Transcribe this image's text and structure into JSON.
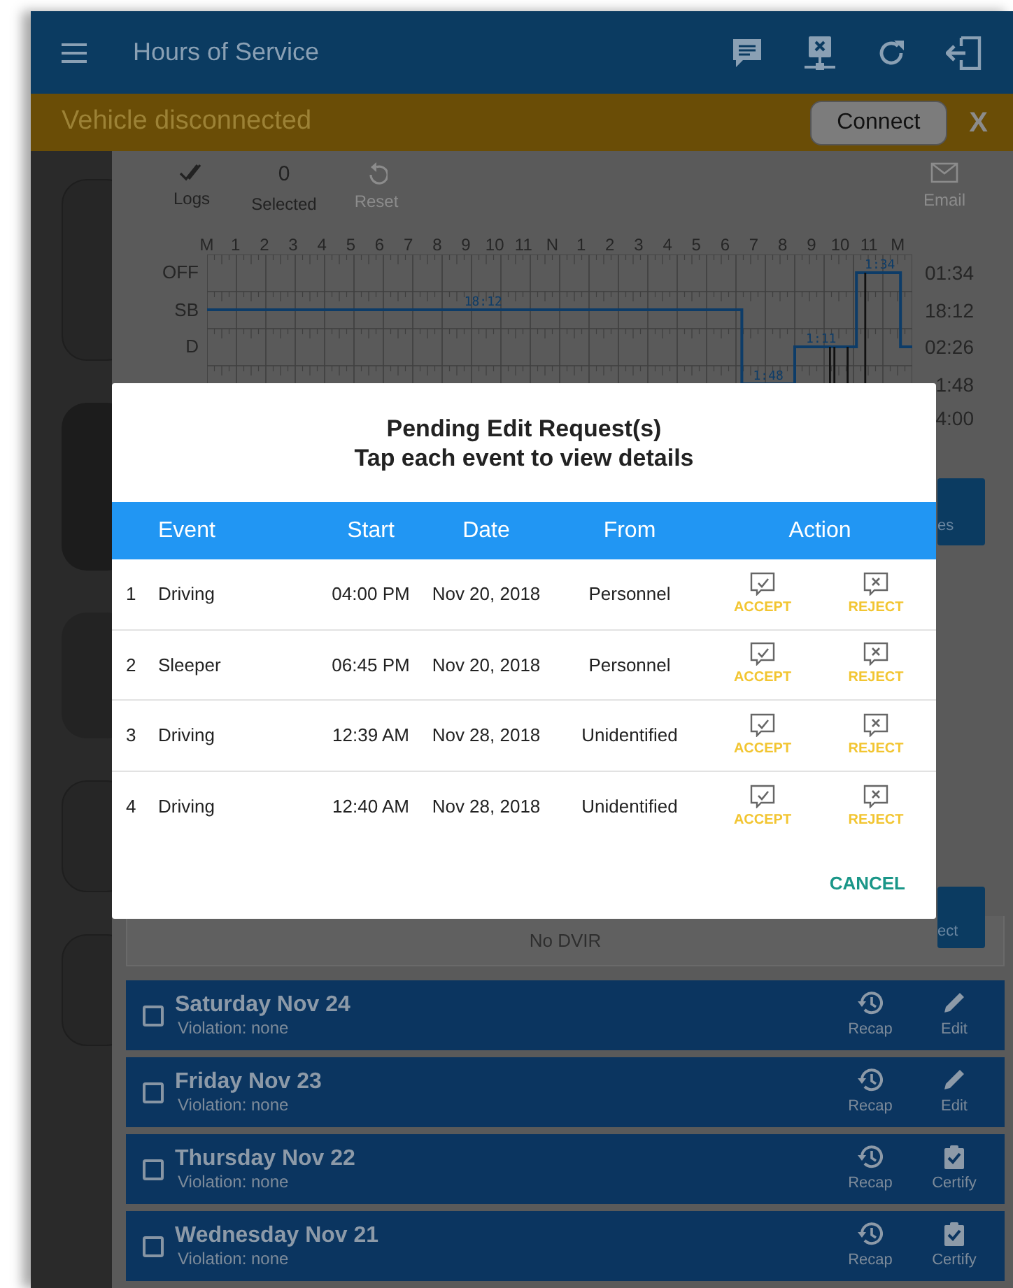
{
  "app_bar": {
    "title": "Hours of Service"
  },
  "banner": {
    "text": "Vehicle disconnected",
    "connect_button": "Connect",
    "close_button": "X"
  },
  "toolbar": [
    {
      "kind": "logs",
      "label": "Logs",
      "disabled": false
    },
    {
      "kind": "count",
      "value": "0",
      "label": "Selected",
      "disabled": false
    },
    {
      "kind": "reset",
      "label": "Reset",
      "disabled": true
    },
    {
      "kind": "email",
      "label": "Email",
      "disabled": true
    }
  ],
  "log_graph": {
    "hour_labels": [
      "M",
      "1",
      "2",
      "3",
      "4",
      "5",
      "6",
      "7",
      "8",
      "9",
      "10",
      "11",
      "N",
      "1",
      "2",
      "3",
      "4",
      "5",
      "6",
      "7",
      "8",
      "9",
      "10",
      "11",
      "M"
    ],
    "rows": [
      {
        "label": "OFF",
        "total": "01:34"
      },
      {
        "label": "SB",
        "total": "18:12"
      },
      {
        "label": "D",
        "total": "02:26"
      },
      {
        "total": "1:48"
      }
    ],
    "grand_total": "4:00",
    "segment_labels": [
      "18:12",
      "1:48",
      "1:11",
      "1:34"
    ]
  },
  "side_buttons": [
    "es",
    "ect"
  ],
  "dvir": {
    "text": "No DVIR"
  },
  "days": [
    {
      "title": "Saturday Nov 24",
      "violation": "Violation: none",
      "checked": false,
      "recap": "Recap",
      "action": {
        "kind": "edit",
        "label": "Edit"
      }
    },
    {
      "title": "Friday Nov 23",
      "violation": "Violation: none",
      "checked": false,
      "recap": "Recap",
      "action": {
        "kind": "edit",
        "label": "Edit"
      }
    },
    {
      "title": "Thursday Nov 22",
      "violation": "Violation: none",
      "checked": false,
      "recap": "Recap",
      "action": {
        "kind": "certify",
        "label": "Certify"
      }
    },
    {
      "title": "Wednesday Nov 21",
      "violation": "Violation: none",
      "checked": false,
      "recap": "Recap",
      "action": {
        "kind": "certify",
        "label": "Certify"
      }
    }
  ],
  "dialog": {
    "title_lines": [
      "Pending Edit Request(s)",
      "Tap each event to view details"
    ],
    "columns": [
      "Event",
      "Start",
      "Date",
      "From",
      "Action"
    ],
    "rows": [
      {
        "number": "1",
        "event": "Driving",
        "start": "04:00 PM",
        "date": "Nov 20, 2018",
        "from": "Personnel",
        "accept": "ACCEPT",
        "reject": "REJECT"
      },
      {
        "number": "2",
        "event": "Sleeper",
        "start": "06:45 PM",
        "date": "Nov 20, 2018",
        "from": "Personnel",
        "accept": "ACCEPT",
        "reject": "REJECT"
      },
      {
        "number": "3",
        "event": "Driving",
        "start": "12:39 AM",
        "date": "Nov 28, 2018",
        "from": "Unidentified",
        "accept": "ACCEPT",
        "reject": "REJECT"
      },
      {
        "number": "4",
        "event": "Driving",
        "start": "12:40 AM",
        "date": "Nov 28, 2018",
        "from": "Unidentified",
        "accept": "ACCEPT",
        "reject": "REJECT"
      }
    ],
    "cancel_button": "CANCEL"
  }
}
